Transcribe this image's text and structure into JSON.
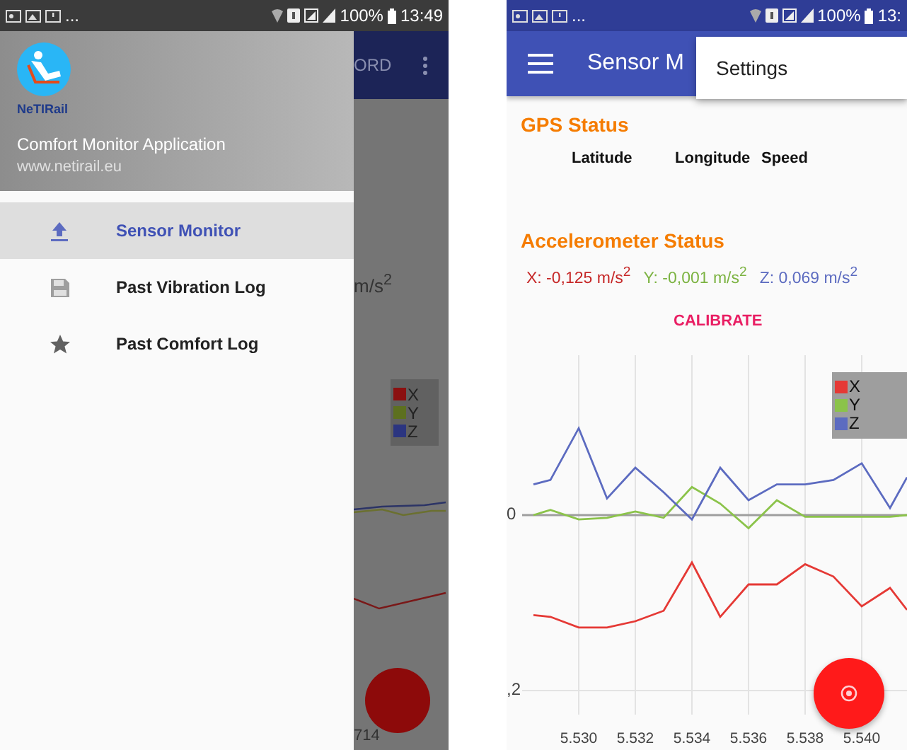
{
  "left_screen": {
    "status_bar": {
      "overflow": "...",
      "battery": "100%",
      "time": "13:49"
    },
    "drawer": {
      "logo_text": "NeTIRail",
      "title": "Comfort Monitor Application",
      "subtitle": "www.netirail.eu",
      "items": [
        {
          "label": "Sensor Monitor",
          "kind": "upload",
          "selected": true
        },
        {
          "label": "Past Vibration Log",
          "kind": "save",
          "selected": false
        },
        {
          "label": "Past Comfort Log",
          "kind": "star",
          "selected": false
        }
      ]
    },
    "behind": {
      "action": "ORD",
      "unit": "m/s$^{2}$",
      "legend": [
        "X",
        "Y",
        "Z"
      ],
      "axis_label": "714"
    }
  },
  "right_screen": {
    "status_bar": {
      "overflow": "...",
      "battery": "100%",
      "time": "13:"
    },
    "app_bar": {
      "title": "Sensor M"
    },
    "menu": {
      "items": [
        "Settings"
      ]
    },
    "gps": {
      "title": "GPS Status",
      "columns": [
        "Latitude",
        "Longitude",
        "Speed"
      ]
    },
    "accelerometer": {
      "title": "Accelerometer Status",
      "readings": [
        {
          "text": "X: -0,125 m/s$^{2}$",
          "color": "#c62828"
        },
        {
          "text": "Y: -0,001 m/s$^{2}$",
          "color": "#7cb342"
        },
        {
          "text": "Z: 0,069 m/s$^{2}$",
          "color": "#5c6bc0"
        }
      ],
      "calibrate": "CALIBRATE"
    },
    "chart": {
      "legend": [
        {
          "label": "X",
          "color": "#e53935"
        },
        {
          "label": "Y",
          "color": "#8bc34a"
        },
        {
          "label": "Z",
          "color": "#5c6bc0"
        }
      ],
      "x_tick_labels": [
        "5.530",
        "5.532",
        "5.534",
        "5.536",
        "5.538",
        "5.540"
      ],
      "y_tick_labels": [
        "0",
        ",2"
      ]
    }
  }
}
